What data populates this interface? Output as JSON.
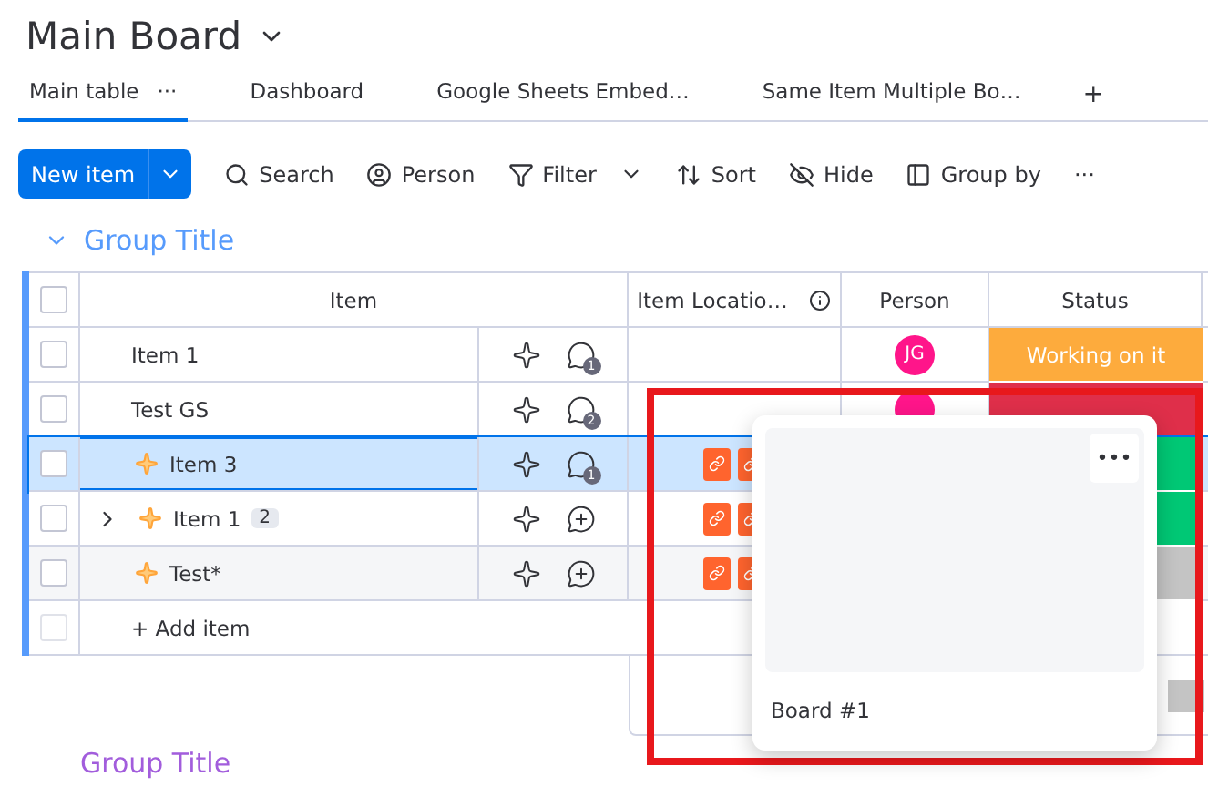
{
  "board": {
    "title": "Main Board"
  },
  "tabs": [
    {
      "label": "Main table",
      "selected": true,
      "menu": "···"
    },
    {
      "label": "Dashboard",
      "selected": false
    },
    {
      "label": "Google Sheets Embed…",
      "selected": false
    },
    {
      "label": "Same Item Multiple Bo…",
      "selected": false
    }
  ],
  "add_tab": "+",
  "toolbar": {
    "new_item": "New item",
    "actions": [
      {
        "label": "Search"
      },
      {
        "label": "Person"
      },
      {
        "label": "Filter",
        "dropdown": true
      },
      {
        "label": "Sort"
      },
      {
        "label": "Hide"
      },
      {
        "label": "Group by"
      }
    ],
    "more": "···"
  },
  "groups": [
    {
      "title": "Group Title",
      "color": "#579bfc",
      "expanded": true,
      "all_checked": false,
      "columns": [
        "Item",
        "Item Locatio…",
        "Person",
        "Status"
      ],
      "rows": [
        {
          "name": "Item 1",
          "checked": false,
          "selected": false,
          "hovered": false,
          "sparkle": false,
          "expandable": false,
          "updates": "1",
          "attachments": [],
          "person": {
            "initials": "JG",
            "color": "#ff158a"
          },
          "status": {
            "label": "Working on it",
            "color": "#fdab3d"
          }
        },
        {
          "name": "Test GS",
          "checked": false,
          "selected": false,
          "hovered": false,
          "sparkle": false,
          "expandable": false,
          "updates": "2",
          "attachments": [],
          "person": {
            "color": "#ff158a"
          },
          "status": {
            "color": "#df2f4a"
          }
        },
        {
          "name": "Item 3",
          "checked": false,
          "selected": true,
          "hovered": false,
          "sparkle": true,
          "expandable": false,
          "updates": "1",
          "attachments": [
            {
              "kind": "link"
            },
            {
              "kind": "link"
            }
          ],
          "status": {
            "color": "#00c875"
          }
        },
        {
          "name": "Item 1",
          "checked": false,
          "selected": false,
          "hovered": false,
          "sparkle": true,
          "expandable": true,
          "subitems": "2",
          "attachments": [
            {
              "kind": "link"
            },
            {
              "kind": "link"
            }
          ],
          "status": {
            "color": "#00c875"
          }
        },
        {
          "name": "Test*",
          "checked": false,
          "selected": false,
          "hovered": true,
          "sparkle": true,
          "expandable": false,
          "attachments": [
            {
              "kind": "link"
            },
            {
              "kind": "link"
            }
          ],
          "status": {
            "color": "#c4c4c4"
          }
        }
      ],
      "add_item": "+ Add item",
      "add_item_disabled": true
    },
    {
      "title": "Group Title",
      "color": "#a25ddc",
      "expanded": false
    }
  ],
  "popup": {
    "title": "Board #1",
    "menu": "•••"
  }
}
